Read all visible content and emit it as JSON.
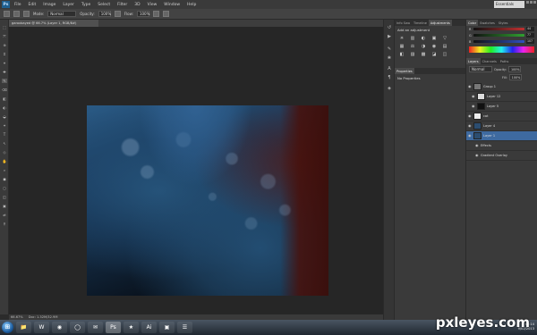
{
  "app": {
    "logo": "Ps"
  },
  "menu": [
    "File",
    "Edit",
    "Image",
    "Layer",
    "Type",
    "Select",
    "Filter",
    "3D",
    "View",
    "Window",
    "Help"
  ],
  "workspace": {
    "value": "Essentials"
  },
  "options_bar": {
    "mode_label": "Mode:",
    "mode_value": "Normal",
    "opacity_label": "Opacity:",
    "opacity_value": "100%",
    "flow_label": "Flow:",
    "flow_value": "100%"
  },
  "document": {
    "tab_title": "garoxbayed @ 66.7% (Layer 1, RGB/8#)",
    "zoom": "66.67%",
    "doc_size": "Doc: 1.32M/32.9M"
  },
  "mid_dock": {
    "tabs": [
      "Info Swa",
      "Timeline",
      "Adjustments"
    ],
    "active_tab": "Adjustments",
    "heading": "Add an adjustment",
    "adjustment_icons": [
      "☀",
      "▥",
      "◐",
      "▣",
      "▽",
      "▦",
      "⚖",
      "◑",
      "◉",
      "▤",
      "◧",
      "▨",
      "▩",
      "◪",
      "◫"
    ],
    "properties_tab": "Properties",
    "properties_text": "No Properties"
  },
  "right_dock": {
    "color_tabs": [
      "Color",
      "Swatches",
      "Styles"
    ],
    "sliders": [
      {
        "label": "R",
        "value": "44",
        "color": "#c03030"
      },
      {
        "label": "G",
        "value": "77",
        "color": "#30a030"
      },
      {
        "label": "B",
        "value": "107",
        "color": "#3050c0"
      }
    ],
    "layers_tabs": [
      "Layers",
      "Channels",
      "Paths"
    ],
    "blend_mode": "Normal",
    "opacity_label": "Opacity:",
    "opacity_value": "100%",
    "fill_label": "Fill:",
    "fill_value": "100%",
    "layers": [
      {
        "name": "Group 1"
      },
      {
        "name": "Layer 12"
      },
      {
        "name": "Layer 5"
      },
      {
        "name": "cat"
      },
      {
        "name": "Layer 4"
      },
      {
        "name": "Layer 1"
      },
      {
        "name": "Effects"
      },
      {
        "name": "Gradient Overlay"
      }
    ],
    "selected_layer": "Layer 1"
  },
  "taskbar": {
    "start_icon": "⊞",
    "apps": [
      "📁",
      "W",
      "◉",
      "◯",
      "✉",
      "Ps",
      "★",
      "Ai",
      "▣",
      "☰"
    ],
    "active_app": "Ps",
    "time": "12:14",
    "date": "9/02/2013"
  },
  "watermark": "pxleyes.com",
  "colors": {
    "accent": "#3e6aa0",
    "artwork_blue": "#1e4a70",
    "artwork_red": "#4a1410"
  }
}
